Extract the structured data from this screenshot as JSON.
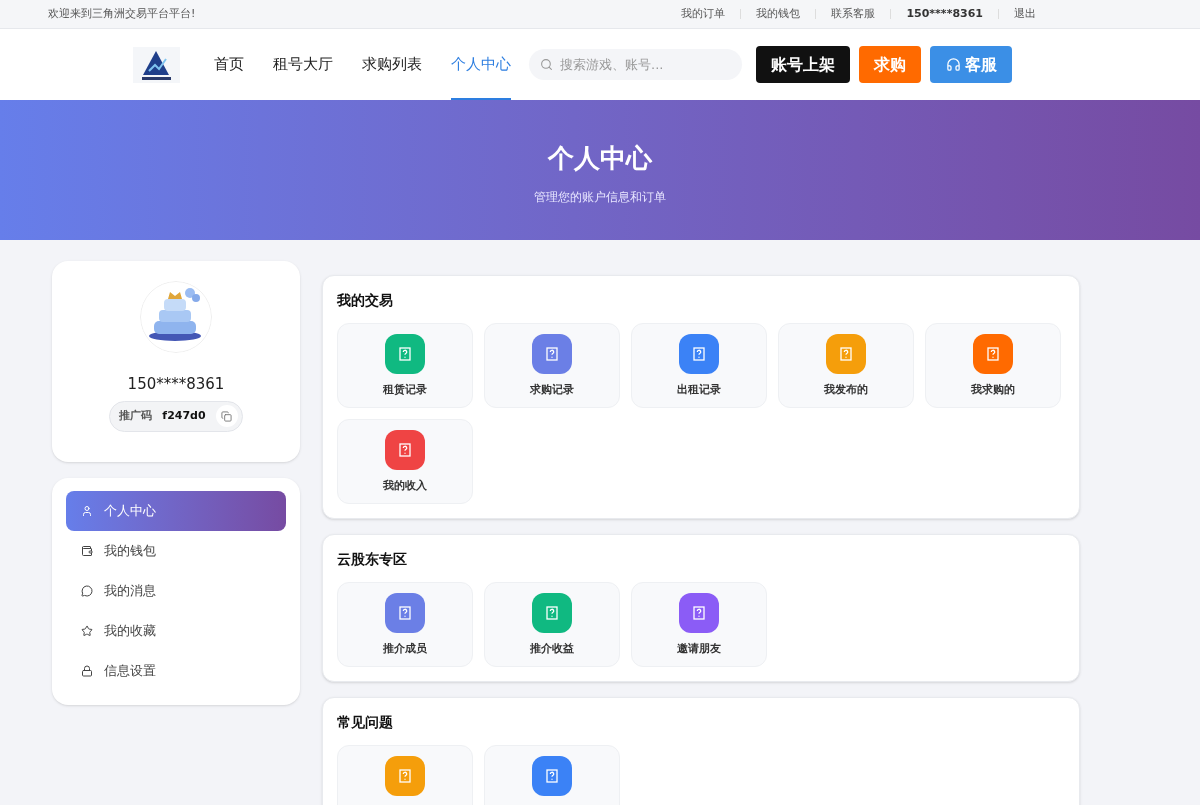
{
  "top_bar": {
    "welcome": "欢迎来到三角洲交易平台平台!",
    "links": [
      "我的订单",
      "我的钱包",
      "联系客服",
      "150****8361",
      "退出"
    ]
  },
  "header": {
    "nav": [
      {
        "label": "首页",
        "selected": false
      },
      {
        "label": "租号大厅",
        "selected": false
      },
      {
        "label": "求购列表",
        "selected": false
      },
      {
        "label": "个人中心",
        "selected": true
      }
    ],
    "search": {
      "placeholder": "搜索游戏、账号..."
    },
    "buttons": [
      {
        "kind": "list",
        "label": "账号上架"
      },
      {
        "kind": "buy",
        "label": "求购"
      },
      {
        "kind": "service",
        "label": "客服"
      }
    ]
  },
  "hero": {
    "title": "个人中心",
    "subtitle": "管理您的账户信息和订单"
  },
  "profile": {
    "phone": "150****8361",
    "promo_label": "推广码",
    "promo_code": "f247d0"
  },
  "sidebar": {
    "items": [
      {
        "label": "个人中心",
        "selected": true
      },
      {
        "label": "我的钱包",
        "selected": false
      },
      {
        "label": "我的消息",
        "selected": false
      },
      {
        "label": "我的收藏",
        "selected": false
      },
      {
        "label": "信息设置",
        "selected": false
      }
    ]
  },
  "sections": [
    {
      "title": "我的交易",
      "tiles": [
        {
          "label": "租赁记录",
          "color": "#10b981"
        },
        {
          "label": "求购记录",
          "color": "#6b7fe6"
        },
        {
          "label": "出租记录",
          "color": "#3b82f6"
        },
        {
          "label": "我发布的",
          "color": "#f59e0b"
        },
        {
          "label": "我求购的",
          "color": "#ff6a00"
        },
        {
          "label": "我的收入",
          "color": "#ef4444"
        }
      ]
    },
    {
      "title": "云股东专区",
      "tiles": [
        {
          "label": "推介成员",
          "color": "#6b7fe6"
        },
        {
          "label": "推介收益",
          "color": "#10b981"
        },
        {
          "label": "邀请朋友",
          "color": "#8b5cf6"
        }
      ]
    },
    {
      "title": "常见问题",
      "tiles": [
        {
          "color": "#f59e0b"
        },
        {
          "color": "#3b82f6"
        }
      ]
    }
  ]
}
